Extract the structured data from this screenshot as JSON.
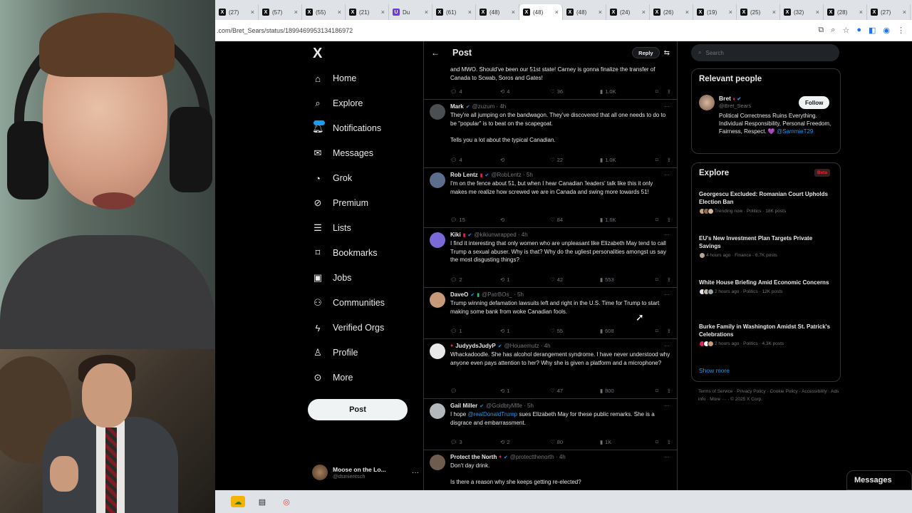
{
  "browser": {
    "tabs": [
      {
        "label": "(27)",
        "icon": "x-icon"
      },
      {
        "label": "(57)",
        "icon": "x-icon"
      },
      {
        "label": "(55)",
        "icon": "x-icon"
      },
      {
        "label": "(21)",
        "icon": "x-icon"
      },
      {
        "label": "Du",
        "icon": "purple-icon"
      },
      {
        "label": "(61)",
        "icon": "x-icon"
      },
      {
        "label": "(48)",
        "icon": "x-icon"
      },
      {
        "label": "(48)",
        "icon": "x-icon"
      },
      {
        "label": "(48)",
        "icon": "x-icon"
      },
      {
        "label": "(24)",
        "icon": "x-icon"
      },
      {
        "label": "(26)",
        "icon": "x-icon"
      },
      {
        "label": "(19)",
        "icon": "x-icon"
      },
      {
        "label": "(25)",
        "icon": "x-icon"
      },
      {
        "label": "(32)",
        "icon": "x-icon"
      },
      {
        "label": "(28)",
        "icon": "x-icon"
      },
      {
        "label": "(27)",
        "icon": "x-icon"
      }
    ],
    "url": ".com/Bret_Sears/status/1899469953134186972"
  },
  "nav": {
    "logo": "X",
    "items": [
      {
        "label": "Home",
        "icon": "home-icon"
      },
      {
        "label": "Explore",
        "icon": "search-icon"
      },
      {
        "label": "Notifications",
        "icon": "bell-icon"
      },
      {
        "label": "Messages",
        "icon": "envelope-icon"
      },
      {
        "label": "Grok",
        "icon": "grok-icon"
      },
      {
        "label": "Premium",
        "icon": "premium-icon"
      },
      {
        "label": "Lists",
        "icon": "list-icon"
      },
      {
        "label": "Bookmarks",
        "icon": "bookmark-icon"
      },
      {
        "label": "Jobs",
        "icon": "briefcase-icon"
      },
      {
        "label": "Communities",
        "icon": "people-icon"
      },
      {
        "label": "Verified Orgs",
        "icon": "lightning-icon"
      },
      {
        "label": "Profile",
        "icon": "user-icon"
      },
      {
        "label": "More",
        "icon": "more-icon"
      }
    ],
    "post_label": "Post",
    "account": {
      "name": "Moose on the Lo...",
      "handle": "@dsmientsch"
    }
  },
  "timeline": {
    "header_title": "Post",
    "reply_label": "Reply",
    "top_fragment": {
      "text": "and MWO. Should've been our 51st state! Carney is gonna finalize the transfer of Canada to Scwab, Soros and Gates!",
      "replies": "4",
      "reposts": "4",
      "likes": "36",
      "views": "1.0K"
    },
    "tweets": [
      {
        "name": "Mark",
        "handle": "@zuzum · 4h",
        "text": "They're all jumping on the bandwagon. They've discovered that all one needs to do to be \"popular\" is to beat on the scapegoat.",
        "text2": "Tells you a lot about the typical Canadian.",
        "replies": "4",
        "reposts": "",
        "likes": "22",
        "views": "1.0K",
        "avatar": "#4b4f54"
      },
      {
        "name": "Rob Lentz",
        "handle": "@RobLentz · 5h",
        "text": "I'm on the fence about 51, but when I hear Canadian 'leaders' talk like this it only makes me realize how screwed we are in Canada and swing more towards 51!",
        "text2": "",
        "replies": "15",
        "reposts": "",
        "likes": "84",
        "views": "1.6K",
        "avatar": "#5b6e8c"
      },
      {
        "name": "Kiki",
        "handle": "@kikiunwrapped · 4h",
        "text": "I find it interesting that only women who are unpleasant like Elizabeth May tend to call Trump a sexual abuser. Why is that? Why do the ugliest personalities amongst us say the most disgusting things?",
        "text2": "",
        "replies": "2",
        "reposts": "1",
        "likes": "42",
        "views": "553",
        "avatar": "#7a6ad8"
      },
      {
        "name": "DaveO",
        "handle": "@PatrBOs_ · 5h",
        "text": "Trump winning defamation lawsuits left and right in the U.S. Time for Trump to start making some bank from woke Canadian fools.",
        "text2": "",
        "replies": "1",
        "reposts": "1",
        "likes": "55",
        "views": "608",
        "avatar": "#c79a7a"
      },
      {
        "name": "JudyydsJudyP",
        "handle": "@Houaemutz · 4h",
        "text": "Whackadoodle. She has alcohol derangement syndrome. I have never understood why anyone even pays attention to her? Why she is given a platform and a microphone?",
        "text2": "",
        "replies": "",
        "reposts": "1",
        "likes": "47",
        "views": "800",
        "avatar": "#e8e8e8"
      },
      {
        "name": "Gail Miller",
        "handle": "@GoldbtyMlfe · 5h",
        "text": "I hope",
        "mention": "@realDonaldTrump",
        "text_after": "sues Elizabeth May for these public remarks. She is a disgrace and embarrassment.",
        "text2": "",
        "replies": "3",
        "reposts": "2",
        "likes": "80",
        "views": "1K",
        "avatar": "#b3b8bd"
      },
      {
        "name": "Protect the North",
        "handle": "@protectthenorth · 4h",
        "text": "Don't day drink.",
        "text2": "Is there a reason why she keeps getting re-elected?",
        "replies": "",
        "reposts": "",
        "likes": "",
        "views": "",
        "avatar": "#6e5c4e"
      }
    ]
  },
  "right": {
    "search_placeholder": "Search",
    "relevant_title": "Relevant people",
    "person": {
      "name": "Bret",
      "handle": "@Bret_Sears",
      "follow_label": "Follow",
      "bio": "Political Correctness Ruins Everything. Individual Responsibility, Personal Freedom, Fairness, Respect. 💜",
      "bio_mention": "@SammieT29"
    },
    "explore_title": "Explore",
    "beta_label": "Beta",
    "trends": [
      {
        "title": "Georgescu Excluded: Romanian Court Upholds Election Ban",
        "meta": "Trending now · Politics · 18K posts"
      },
      {
        "title": "EU's New Investment Plan Targets Private Savings",
        "meta": "4 hours ago · Finance · 6.7K posts"
      },
      {
        "title": "White House Briefing Amid Economic Concerns",
        "meta": "2 hours ago · Politics · 12K posts"
      },
      {
        "title": "Burke Family in Washington Amidst St. Patrick's Celebrations",
        "meta": "2 hours ago · Politics · 4.3K posts"
      }
    ],
    "show_more": "Show more",
    "footer": "Terms of Service · Privacy Policy · Cookie Policy · Accessibility · Ads info · More ··· · © 2025 X Corp.",
    "messages_label": "Messages"
  }
}
